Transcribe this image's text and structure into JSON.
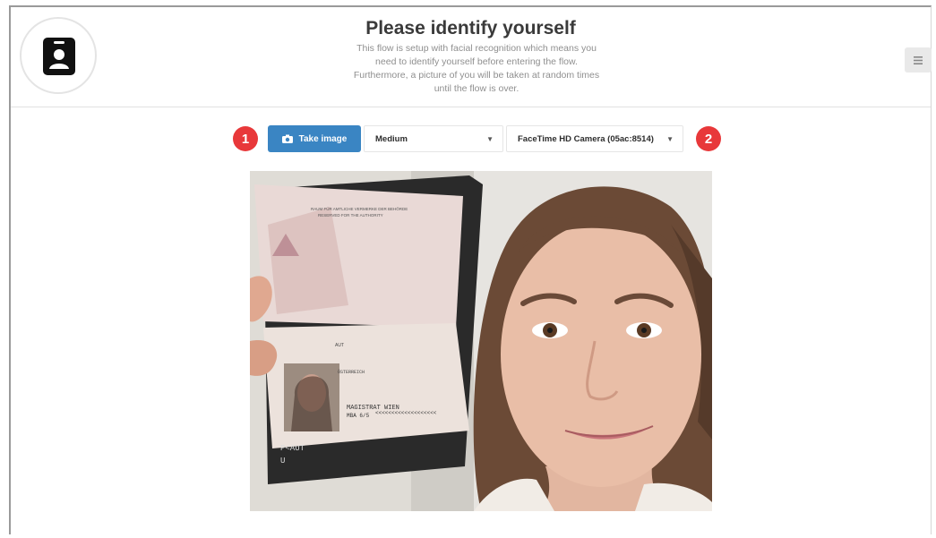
{
  "header": {
    "title": "Please identify yourself",
    "subtitle_lines": [
      "This flow is setup with facial recognition which means you",
      "need to identify yourself before entering the flow.",
      "Furthermore, a picture of you will be taken at random times",
      "until the flow is over."
    ],
    "badge_icon": "id-badge-icon",
    "menu_icon": "hamburger-menu-icon"
  },
  "toolbar": {
    "step_one": "1",
    "step_two": "2",
    "take_image_label": "Take image",
    "camera_icon": "camera-icon",
    "quality_select_value": "Medium",
    "camera_select_value": "FaceTime HD Camera (05ac:8514)"
  },
  "camera_feed": {
    "passport_text": {
      "authority_line_1": "RAUM FÜR AMTLICHE VERMERKE DER BEHÖRDE",
      "authority_line_2": "RESERVED FOR THE AUTHORITY",
      "country": "AUT",
      "nationality": "ÖSTERREICH",
      "authority": "MAGISTRAT WIEN",
      "authority_code": "MBA 6/5",
      "mrz_fragment": "<<<<<<<<<<<<<<<<<<<",
      "mrz_line_1": "P<AUT",
      "mrz_line_2": "U"
    }
  },
  "colors": {
    "primary_button": "#3a85c3",
    "step_badge": "#e8383a",
    "border": "#e1e1e1"
  }
}
